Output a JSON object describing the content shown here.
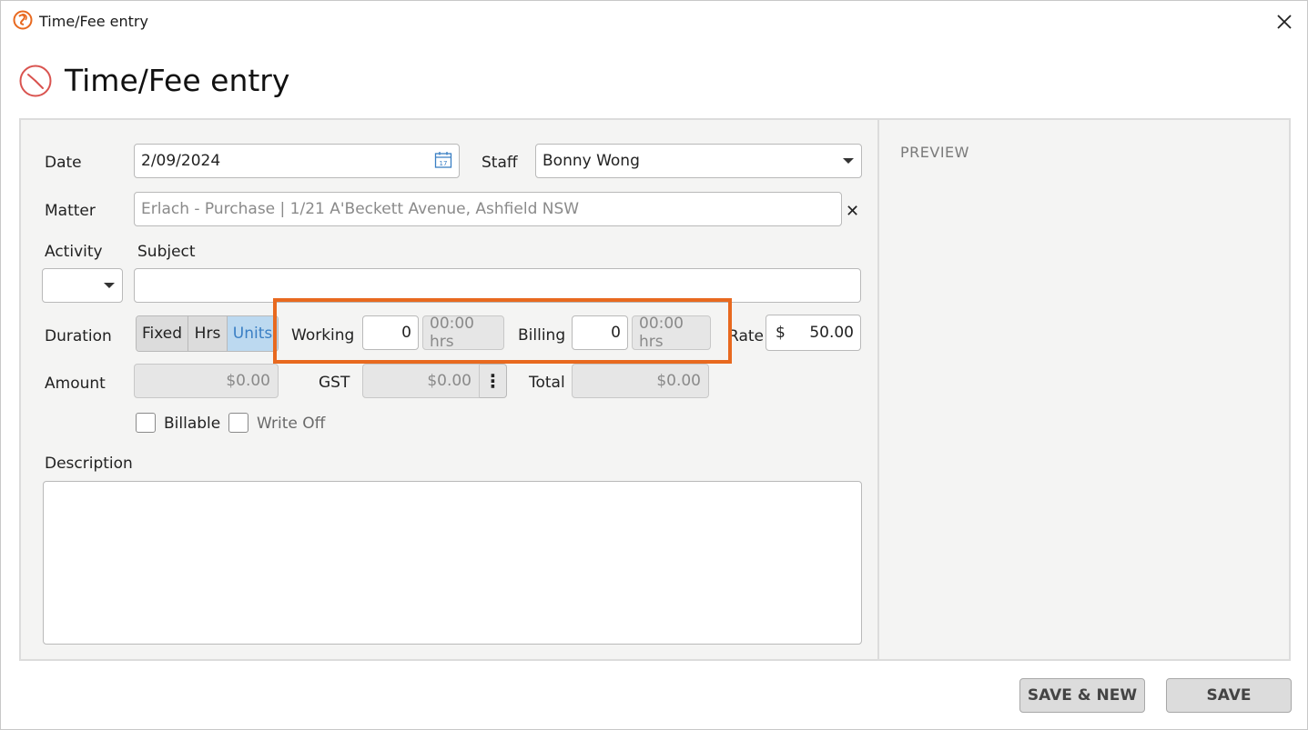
{
  "window": {
    "title": "Time/Fee entry"
  },
  "header": {
    "title": "Time/Fee entry"
  },
  "form": {
    "date": {
      "label": "Date",
      "value": "2/09/2024"
    },
    "staff": {
      "label": "Staff",
      "value": "Bonny Wong"
    },
    "matter": {
      "label": "Matter",
      "value": "Erlach - Purchase | 1/21 A'Beckett Avenue, Ashfield NSW",
      "clear": "✕"
    },
    "activity": {
      "label": "Activity",
      "value": ""
    },
    "subject": {
      "label": "Subject",
      "value": ""
    },
    "duration": {
      "label": "Duration",
      "options": [
        "Fixed",
        "Hrs",
        "Units"
      ],
      "selected": "Units"
    },
    "working": {
      "label": "Working",
      "units": "0",
      "hrs": "00:00 hrs"
    },
    "billing": {
      "label": "Billing",
      "units": "0",
      "hrs": "00:00 hrs"
    },
    "rate": {
      "label": "Rate",
      "currency": "$",
      "value": "50.00"
    },
    "amount": {
      "label": "Amount",
      "value": "$0.00"
    },
    "gst": {
      "label": "GST",
      "value": "$0.00"
    },
    "total": {
      "label": "Total",
      "value": "$0.00"
    },
    "billable": {
      "label": "Billable",
      "checked": false
    },
    "write_off": {
      "label": "Write Off",
      "checked": false
    },
    "description": {
      "label": "Description",
      "value": ""
    }
  },
  "preview": {
    "label": "PREVIEW"
  },
  "buttons": {
    "save_new": "SAVE & NEW",
    "save": "SAVE"
  },
  "colors": {
    "highlight": "#e8691f",
    "active_segment": "#bcd9f0",
    "brand": "#e8691f"
  }
}
